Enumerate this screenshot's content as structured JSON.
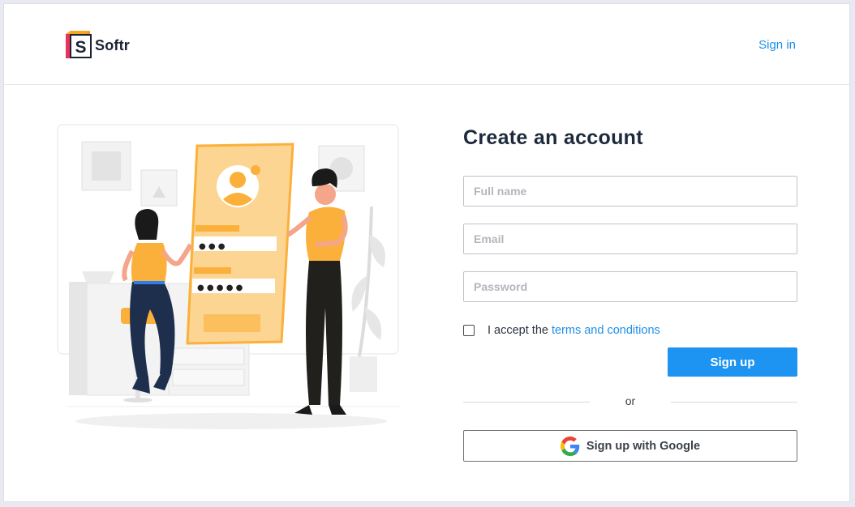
{
  "header": {
    "brand_name": "Softr",
    "sign_in_label": "Sign in"
  },
  "form": {
    "title": "Create an account",
    "full_name_placeholder": "Full name",
    "email_placeholder": "Email",
    "password_placeholder": "Password",
    "terms_prefix": "I accept the",
    "terms_link": "terms and conditions",
    "terms_accepted": false,
    "signup_label": "Sign up",
    "or_label": "or",
    "google_label": "Sign up with Google"
  },
  "illustration": {
    "password_dots_short": "● ● ●",
    "password_dots_long": "● ● ● ● ●"
  },
  "colors": {
    "accent": "#1d94f2",
    "link": "#1d8fe8",
    "illustration_primary": "#fbb03b",
    "illustration_light": "#fcd593",
    "logo_pink": "#e8335d",
    "logo_orange": "#f6a623"
  }
}
